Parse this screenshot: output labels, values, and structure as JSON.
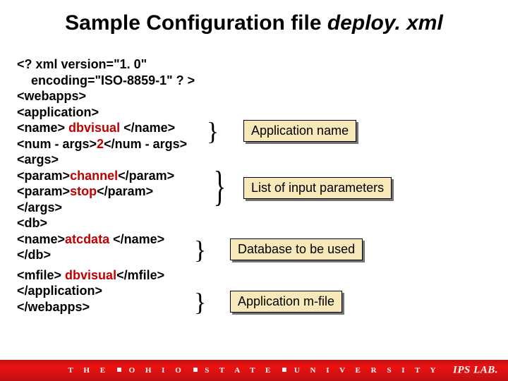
{
  "title": {
    "prefix": "Sample Configuration file ",
    "filename": "deploy. xml"
  },
  "code": {
    "l1": "<? xml version=\"1. 0\"",
    "l2_indent": "    encoding=\"ISO-8859-1\" ? >",
    "l3": "<webapps>",
    "l4": "<application>",
    "l5_a": "<name> ",
    "l5_v": "dbvisual",
    "l5_b": " </name>",
    "l6_a": "<num - args>",
    "l6_v": "2",
    "l6_b": "</num - args>",
    "l7": "<args>",
    "l8_a": "<param>",
    "l8_v": "channel",
    "l8_b": "</param>",
    "l9_a": "<param>",
    "l9_v": "stop",
    "l9_b": "</param>",
    "l10": "</args>",
    "l11": "<db>",
    "l12_a": "<name>",
    "l12_v": "atcdata",
    "l12_b": " </name>",
    "l13": "</db>",
    "l14_a": "<mfile> ",
    "l14_v": "dbvisual",
    "l14_b": "</mfile>",
    "l15": "</application>",
    "l16": "</webapps>"
  },
  "callouts": {
    "c1": "Application name",
    "c2": "List of input parameters",
    "c3": "Database to be used",
    "c4": "Application m-file"
  },
  "footer": {
    "uni_a": "T H E",
    "uni_b": "O H I O",
    "uni_c": "S T A T E",
    "uni_d": "U N I V E R S I T Y",
    "lab": "IPS LAB."
  }
}
